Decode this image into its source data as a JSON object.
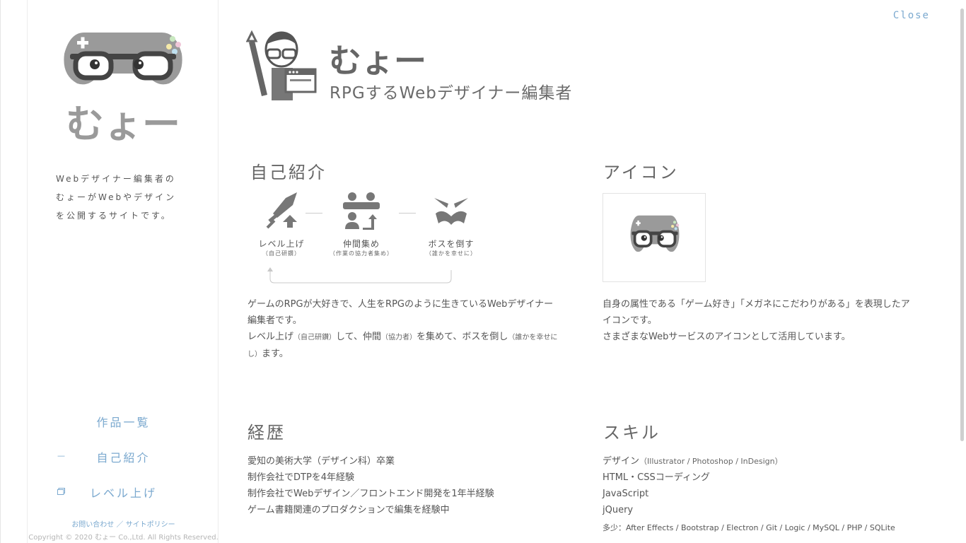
{
  "colors": {
    "accent": "#7ba9cf",
    "text": "#555555",
    "icon_gray": "#9a9a9a"
  },
  "sidebar": {
    "logo_text": "むょー",
    "desc": [
      "Webデザイナー編集者の",
      "むょーがWebやデザイン",
      "を公開するサイトです。"
    ],
    "nav": [
      {
        "label": "作品一覧",
        "marker": ""
      },
      {
        "label": "自己紹介",
        "marker": "—"
      },
      {
        "label": "レベル上げ",
        "marker": "window-icon"
      }
    ],
    "footer_contact": "お問い合わせ",
    "footer_sep": "／",
    "footer_policy": "サイトポリシー",
    "copyright": "Copyright © 2020 むょー Co.,Ltd. All Rights Reserved."
  },
  "close_label": "Close",
  "hero": {
    "name": "むょー",
    "tagline": "RPGするWebデザイナー編集者"
  },
  "intro": {
    "title": "自己紹介",
    "steps": [
      {
        "label": "レベル上げ",
        "sub": "（自己研鑽）",
        "icon": "sword-level-up-icon"
      },
      {
        "label": "仲間集め",
        "sub": "（作業の協力者集め）",
        "icon": "party-members-icon"
      },
      {
        "label": "ボスを倒す",
        "sub": "（誰かを幸せに）",
        "icon": "boss-face-icon"
      }
    ],
    "p1_line1": "ゲームのRPGが大好きで、人生をRPGのように生きているWebデザイナー",
    "p1_line2": "編集者です。",
    "p2_a": "レベル上げ",
    "p2_a_small": "（自己研鑽）",
    "p2_b": "して、仲間",
    "p2_b_small": "（協力者）",
    "p2_c": "を集めて、ボスを倒し",
    "p2_c_small": "（誰かを幸せに",
    "p2_d_small": "し）",
    "p2_e": "ます。"
  },
  "icon_section": {
    "title": "アイコン",
    "line1": "自身の属性である「ゲーム好き」「メガネにこだわりがある」を表現したア",
    "line2": "イコンです。",
    "line3": "さまざまなWebサービスのアイコンとして活用しています。"
  },
  "career": {
    "title": "経歴",
    "items": [
      "愛知の美術大学（デザイン科）卒業",
      "制作会社でDTPを4年経験",
      "制作会社でWebデザイン／フロントエンド開発を1年半経験",
      "ゲーム書籍関連のプロダクションで編集を経験中"
    ]
  },
  "skills": {
    "title": "スキル",
    "design": "デザイン",
    "design_tools": "（Illustrator / Photoshop / InDesign）",
    "items": [
      "HTML・CSSコーディング",
      "JavaScript",
      "jQuery"
    ],
    "more": "多少：After Effects / Bootstrap / Electron / Git / Logic / MySQL / PHP / SQLite"
  }
}
